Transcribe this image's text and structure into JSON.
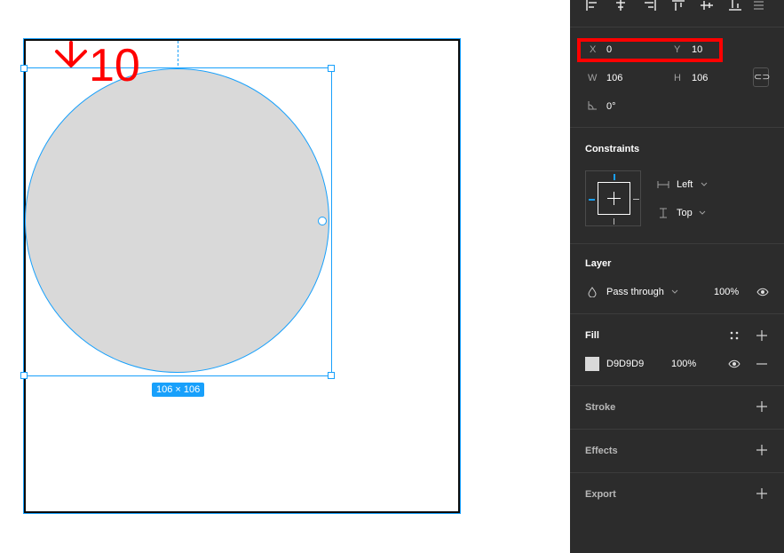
{
  "canvas": {
    "size_badge": "106 × 106",
    "annotation": "10"
  },
  "panel": {
    "position": {
      "x_label": "X",
      "x_value": "0",
      "y_label": "Y",
      "y_value": "10",
      "w_label": "W",
      "w_value": "106",
      "h_label": "H",
      "h_value": "106",
      "rotation_value": "0°"
    },
    "constraints": {
      "title": "Constraints",
      "horizontal": "Left",
      "vertical": "Top"
    },
    "layer": {
      "title": "Layer",
      "blend_mode": "Pass through",
      "opacity": "100%"
    },
    "fill": {
      "title": "Fill",
      "color_hex": "D9D9D9",
      "opacity": "100%"
    },
    "stroke": {
      "title": "Stroke"
    },
    "effects": {
      "title": "Effects"
    },
    "export": {
      "title": "Export"
    }
  },
  "colors": {
    "selection": "#18a0fb",
    "panel_bg": "#2c2c2c",
    "fill": "#d9d9d9",
    "annotation": "#ff0000"
  }
}
